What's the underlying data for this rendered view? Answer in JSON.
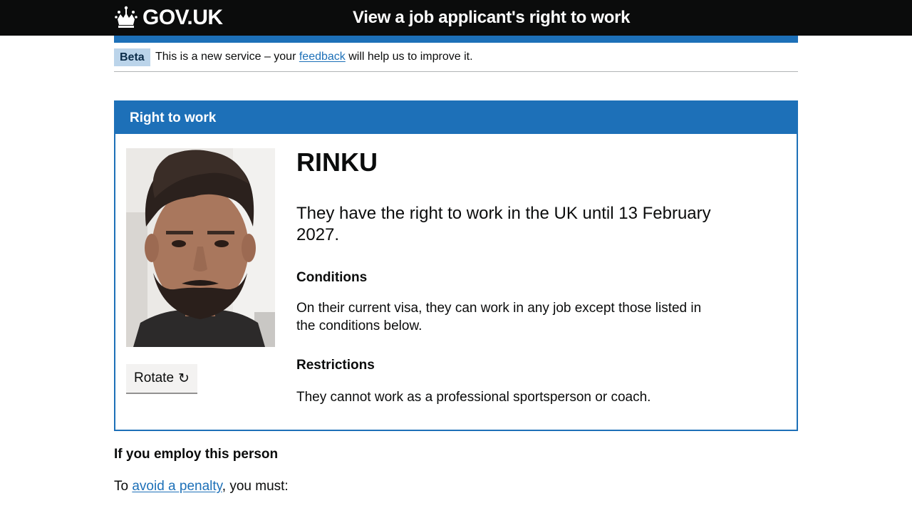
{
  "header": {
    "logo_text": "GOV.UK",
    "service_name": "View a job applicant's right to work"
  },
  "phase_banner": {
    "tag": "Beta",
    "text_before": "This is a new service – your ",
    "link_text": "feedback",
    "text_after": " will help us to improve it."
  },
  "panel": {
    "heading": "Right to work",
    "photo_icon": "applicant-photo",
    "rotate_label": "Rotate",
    "rotate_icon": "↻",
    "name": "RINKU",
    "status": "They have the right to work in the UK until 13 February 2027.",
    "conditions_heading": "Conditions",
    "conditions_text": "On their current visa, they can work in any job except those listed in the conditions below.",
    "restrictions_heading": "Restrictions",
    "restrictions_text": "They cannot work as a professional sportsperson or coach."
  },
  "employ": {
    "heading": "If you employ this person",
    "text_before": "To ",
    "link_text": "avoid a penalty",
    "text_after": ", you must:"
  },
  "colors": {
    "header_bg": "#0b0c0c",
    "brand_blue": "#1d70b8",
    "link": "#1d70b8",
    "tag_bg": "#bbd4ea",
    "button_bg": "#f3f2f1"
  }
}
